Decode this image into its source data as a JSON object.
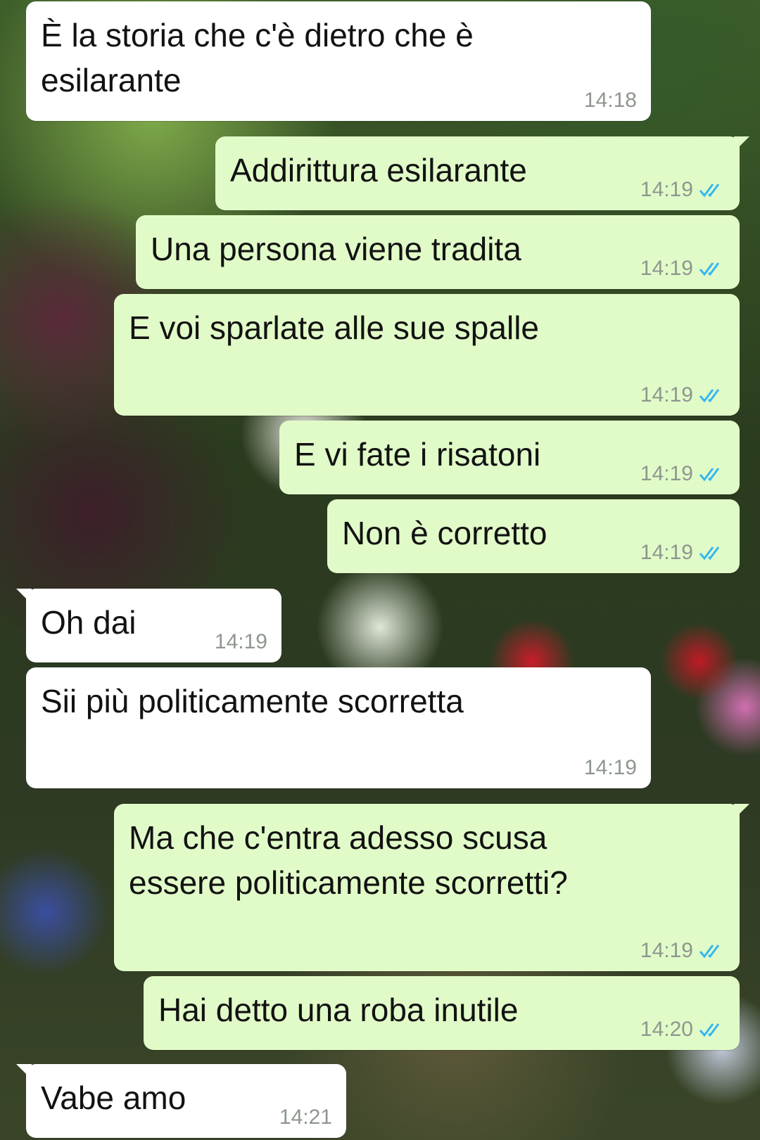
{
  "messages": [
    {
      "text": "È la storia che c'è dietro che è\nesilarante",
      "time": "14:18",
      "dir": "in"
    },
    {
      "text": "Addirittura esilarante",
      "time": "14:19",
      "dir": "out"
    },
    {
      "text": "Una persona viene tradita",
      "time": "14:19",
      "dir": "out"
    },
    {
      "text": "E voi sparlate alle sue spalle",
      "time": "14:19",
      "dir": "out"
    },
    {
      "text": "E vi fate i risatoni",
      "time": "14:19",
      "dir": "out"
    },
    {
      "text": "Non è corretto",
      "time": "14:19",
      "dir": "out"
    },
    {
      "text": "Oh dai",
      "time": "14:19",
      "dir": "in"
    },
    {
      "text": "Sii più politicamente scorretta",
      "time": "14:19",
      "dir": "in"
    },
    {
      "text": "Ma che c'entra adesso scusa\nessere politicamente scorretti?",
      "time": "14:19",
      "dir": "out"
    },
    {
      "text": "Hai detto una roba inutile",
      "time": "14:20",
      "dir": "out"
    },
    {
      "text": "Vabe amo",
      "time": "14:21",
      "dir": "in"
    }
  ],
  "colors": {
    "incoming": "#ffffff",
    "outgoing": "#e1fbc8",
    "read_ticks": "#34b7f1",
    "time_text": "#8e968e"
  },
  "icons": {
    "read_receipt": "double-check-icon"
  }
}
